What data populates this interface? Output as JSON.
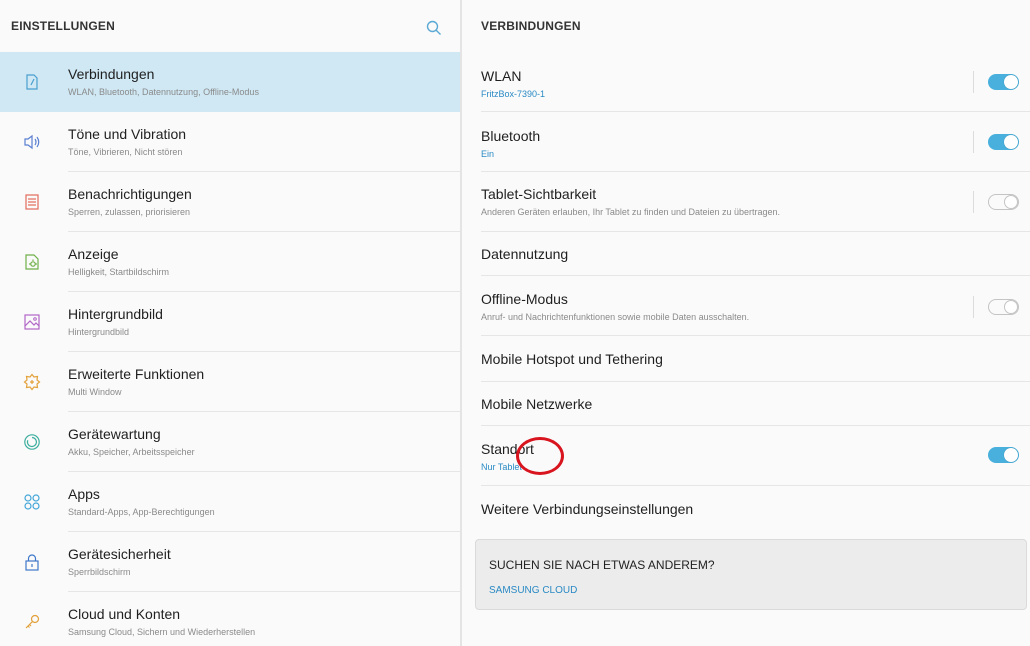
{
  "left_panel": {
    "title": "EINSTELLUNGEN",
    "items": [
      {
        "title": "Verbindungen",
        "subtitle": "WLAN, Bluetooth, Datennutzung, Offline-Modus"
      },
      {
        "title": "Töne und Vibration",
        "subtitle": "Töne, Vibrieren, Nicht stören"
      },
      {
        "title": "Benachrichtigungen",
        "subtitle": "Sperren, zulassen, priorisieren"
      },
      {
        "title": "Anzeige",
        "subtitle": "Helligkeit, Startbildschirm"
      },
      {
        "title": "Hintergrundbild",
        "subtitle": "Hintergrundbild"
      },
      {
        "title": "Erweiterte Funktionen",
        "subtitle": "Multi Window"
      },
      {
        "title": "Gerätewartung",
        "subtitle": "Akku, Speicher, Arbeitsspeicher"
      },
      {
        "title": "Apps",
        "subtitle": "Standard-Apps, App-Berechtigungen"
      },
      {
        "title": "Gerätesicherheit",
        "subtitle": "Sperrbildschirm"
      },
      {
        "title": "Cloud und Konten",
        "subtitle": "Samsung Cloud, Sichern und Wiederherstellen"
      }
    ]
  },
  "right_panel": {
    "title": "VERBINDUNGEN",
    "items": [
      {
        "title": "WLAN",
        "subtitle": "FritzBox-7390-1",
        "toggle": "on"
      },
      {
        "title": "Bluetooth",
        "subtitle": "Ein",
        "toggle": "on"
      },
      {
        "title": "Tablet-Sichtbarkeit",
        "subtitle": "Anderen Geräten erlauben, Ihr Tablet zu finden und Dateien zu übertragen.",
        "toggle": "off"
      },
      {
        "title": "Datennutzung"
      },
      {
        "title": "Offline-Modus",
        "subtitle": "Anruf- und Nachrichtenfunktionen sowie mobile Daten ausschalten.",
        "toggle": "off"
      },
      {
        "title": "Mobile Hotspot und Tethering"
      },
      {
        "title": "Mobile Netzwerke"
      },
      {
        "title": "Standort",
        "subtitle": "Nur Tablet",
        "toggle": "on"
      },
      {
        "title": "Weitere Verbindungseinstellungen"
      }
    ],
    "card": {
      "title": "SUCHEN SIE NACH ETWAS ANDEREM?",
      "link": "SAMSUNG CLOUD"
    }
  },
  "colors": {
    "accent": "#49b0dd",
    "selected_bg": "#cfe8f4",
    "link_blue": "#2a8ac4",
    "annotation_red": "#d8141e"
  },
  "icons": [
    "search-icon",
    "connections-icon",
    "sound-icon",
    "notifications-icon",
    "display-icon",
    "wallpaper-icon",
    "advanced-features-icon",
    "device-maintenance-icon",
    "apps-icon",
    "lock-icon",
    "key-icon"
  ]
}
